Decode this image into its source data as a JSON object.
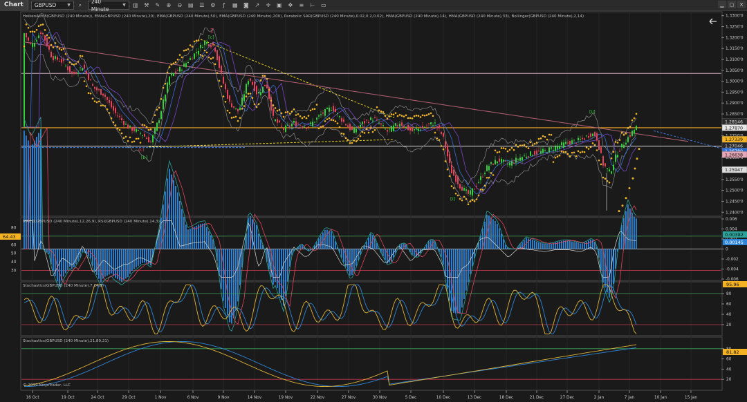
{
  "toolbar": {
    "title": "Chart",
    "instrument": "GBPUSD",
    "interval": "240 Minute",
    "icons": [
      "search-icon",
      "bar-type-icon",
      "draw-icon",
      "pencil-icon",
      "zoom-in-icon",
      "zoom-out-icon",
      "chart-trader-icon",
      "properties-icon",
      "strategy-icon",
      "indicators-icon",
      "grid-icon",
      "camera-icon",
      "share-icon",
      "crosshair-icon",
      "data-box-icon",
      "pan-icon",
      "list-icon",
      "ruler-icon",
      "calendar-icon"
    ],
    "window_controls": [
      "minimize",
      "maximize",
      "close"
    ]
  },
  "colors": {
    "background": "#1a1a1a",
    "up": "#36d13e",
    "down": "#e2455c",
    "sar": "#f0b429",
    "support_line": "#f5a623",
    "pivot_line": "#c7a9b7",
    "macd_hist": "#2f86d8"
  },
  "price_panel": {
    "indicator_text": "HeikenAshi8(GBPUSD (240 Minute)), EMA(GBPUSD (240 Minute),20), EMA(GBPUSD (240 Minute),50), EMA(GBPUSD (240 Minute),200), Parabolic SAR(GBPUSD (240 Minute),0.02,0.2,0.02), HMA(GBPUSD (240 Minute),14), HMA(GBPUSD (240 Minute),33), Bollinger(GBPUSD (240 Minute),2,14)",
    "axis_ticks": [
      "1.3300'0",
      "1.3250'0",
      "1.3200'0",
      "1.3150'0",
      "1.3100'0",
      "1.3050'0",
      "1.3000'0",
      "1.2950'0",
      "1.2900'0",
      "1.2850'0",
      "1.2800'0",
      "1.2750'0",
      "1.2700'0",
      "1.2650'0",
      "1.2600'0",
      "1.2550'0",
      "1.2500'0",
      "1.2450'0",
      "1.2400'0"
    ],
    "y_range": [
      1.2385,
      1.3315
    ],
    "badges": [
      {
        "text": "1.28146",
        "value": 1.2815,
        "bg": "#2a2a2a",
        "fg": "#dddddd"
      },
      {
        "text": "1.27870",
        "value": 1.2787,
        "bg": "#e6e6e6",
        "fg": "#111111"
      },
      {
        "text": "1.27339",
        "value": 1.2734,
        "bg": "#f5b323",
        "fg": "#111111"
      },
      {
        "text": "1.27046",
        "value": 1.2705,
        "bg": "#2a2a2a",
        "fg": "#dddddd"
      },
      {
        "text": "1.26780",
        "value": 1.268,
        "bg": "#2f6fd8",
        "fg": "#ffffff"
      },
      {
        "text": "1.26638",
        "value": 1.2664,
        "bg": "#e6a6b6",
        "fg": "#111111"
      },
      {
        "text": "1.25947",
        "value": 1.2595,
        "bg": "#dddddd",
        "fg": "#111111"
      }
    ],
    "wave_labels": [
      {
        "text": "2",
        "color": "#e2455c"
      },
      {
        "text": "[c]",
        "color": "#36d13e"
      },
      {
        "text": "(c)",
        "color": "#e2455c"
      },
      {
        "text": "[b]",
        "color": "#36d13e"
      },
      {
        "text": "[i]",
        "color": "#36d13e"
      },
      {
        "text": "[ii]",
        "color": "#36d13e"
      }
    ]
  },
  "macd_panel": {
    "title": "MACD(GBPUSD (240 Minute),12,26,9), RSI(GBPUSD (240 Minute),14,3)",
    "right_ticks": [
      "0.006",
      "0.004",
      "0.002",
      "0",
      "-0.002",
      "-0.004",
      "-0.006"
    ],
    "left_ticks": [
      "80",
      "70",
      "60",
      "50",
      "40",
      "30"
    ],
    "left_badge": "64.43",
    "right_badges": [
      "0.00382",
      "0.00145"
    ]
  },
  "stoch1_panel": {
    "title": "Stochastics(GBPUSD (240 Minute),7,14,3)",
    "ticks": [
      "80",
      "60",
      "40",
      "20"
    ],
    "badge": "95.96"
  },
  "stoch2_panel": {
    "title": "Stochastics(GBPUSD (240 Minute),21,89,21)",
    "ticks": [
      "80",
      "60",
      "40",
      "20"
    ],
    "badge": "81.82",
    "copyright": "© 2019 NinjaTrader, LLC"
  },
  "x_axis": {
    "labels": [
      "16 Oct",
      "19 Oct",
      "24 Oct",
      "29 Oct",
      "1 Nov",
      "6 Nov",
      "9 Nov",
      "14 Nov",
      "19 Nov",
      "22 Nov",
      "27 Nov",
      "30 Nov",
      "5 Dec",
      "10 Dec",
      "13 Dec",
      "18 Dec",
      "21 Dec",
      "27 Dec",
      "2 Jan",
      "7 Jan",
      "10 Jan",
      "15 Jan"
    ]
  }
}
